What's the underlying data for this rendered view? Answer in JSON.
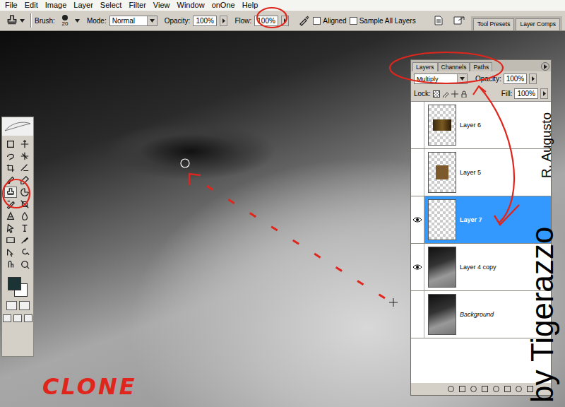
{
  "menu": [
    "File",
    "Edit",
    "Image",
    "Layer",
    "Select",
    "Filter",
    "View",
    "Window",
    "onOne",
    "Help"
  ],
  "options_bar": {
    "brush_label": "Brush:",
    "brush_size": "20",
    "mode_label": "Mode:",
    "mode": "Normal",
    "opacity_label": "Opacity:",
    "opacity": "100%",
    "flow_label": "Flow:",
    "flow": "100%",
    "aligned": {
      "label": "Aligned",
      "checked": false
    },
    "sample_all_layers": {
      "label": "Sample All Layers",
      "checked": false
    }
  },
  "palette_well": [
    {
      "label": "Tool Presets"
    },
    {
      "label": "Layer Comps"
    }
  ],
  "tools": [
    {
      "selected": false
    },
    {
      "selected": false
    },
    {
      "selected": false
    },
    {
      "selected": false
    },
    {
      "selected": false
    },
    {
      "selected": false
    },
    {
      "selected": false
    },
    {
      "selected": false
    },
    {
      "selected": true
    },
    {
      "selected": false
    },
    {
      "selected": false
    },
    {
      "selected": false
    },
    {
      "selected": false
    },
    {
      "selected": false
    },
    {
      "selected": false
    },
    {
      "selected": false
    },
    {
      "selected": false
    },
    {
      "selected": false
    },
    {
      "selected": false
    },
    {
      "selected": false
    },
    {
      "selected": false
    },
    {
      "selected": false
    }
  ],
  "swatches": {
    "foreground": "#1c3335",
    "background": "#ffffff"
  },
  "layers_panel": {
    "tabs": [
      {
        "label": "Layers",
        "selected": true
      },
      {
        "label": "Channels",
        "selected": false
      },
      {
        "label": "Paths",
        "selected": false
      }
    ],
    "blend_mode": "Multiply",
    "opacity_label": "Opacity:",
    "opacity": "100%",
    "lock_label": "Lock:",
    "fill_label": "Fill:",
    "fill": "100%",
    "layers": [
      {
        "name": "Layer 6",
        "visible": false,
        "selected": false,
        "italic": false,
        "kind": "strip"
      },
      {
        "name": "Layer 5",
        "visible": false,
        "selected": false,
        "italic": false,
        "kind": "square"
      },
      {
        "name": "Layer 7",
        "visible": true,
        "selected": true,
        "italic": false,
        "kind": "empty"
      },
      {
        "name": "Layer 4 copy",
        "visible": true,
        "selected": false,
        "italic": false,
        "kind": "photo"
      },
      {
        "name": "Background",
        "visible": false,
        "selected": false,
        "italic": true,
        "kind": "photo"
      }
    ]
  },
  "annotations": {
    "label": "CLONE",
    "credit_small": "R. Augusto",
    "credit_large": "by Tigerazzo"
  }
}
